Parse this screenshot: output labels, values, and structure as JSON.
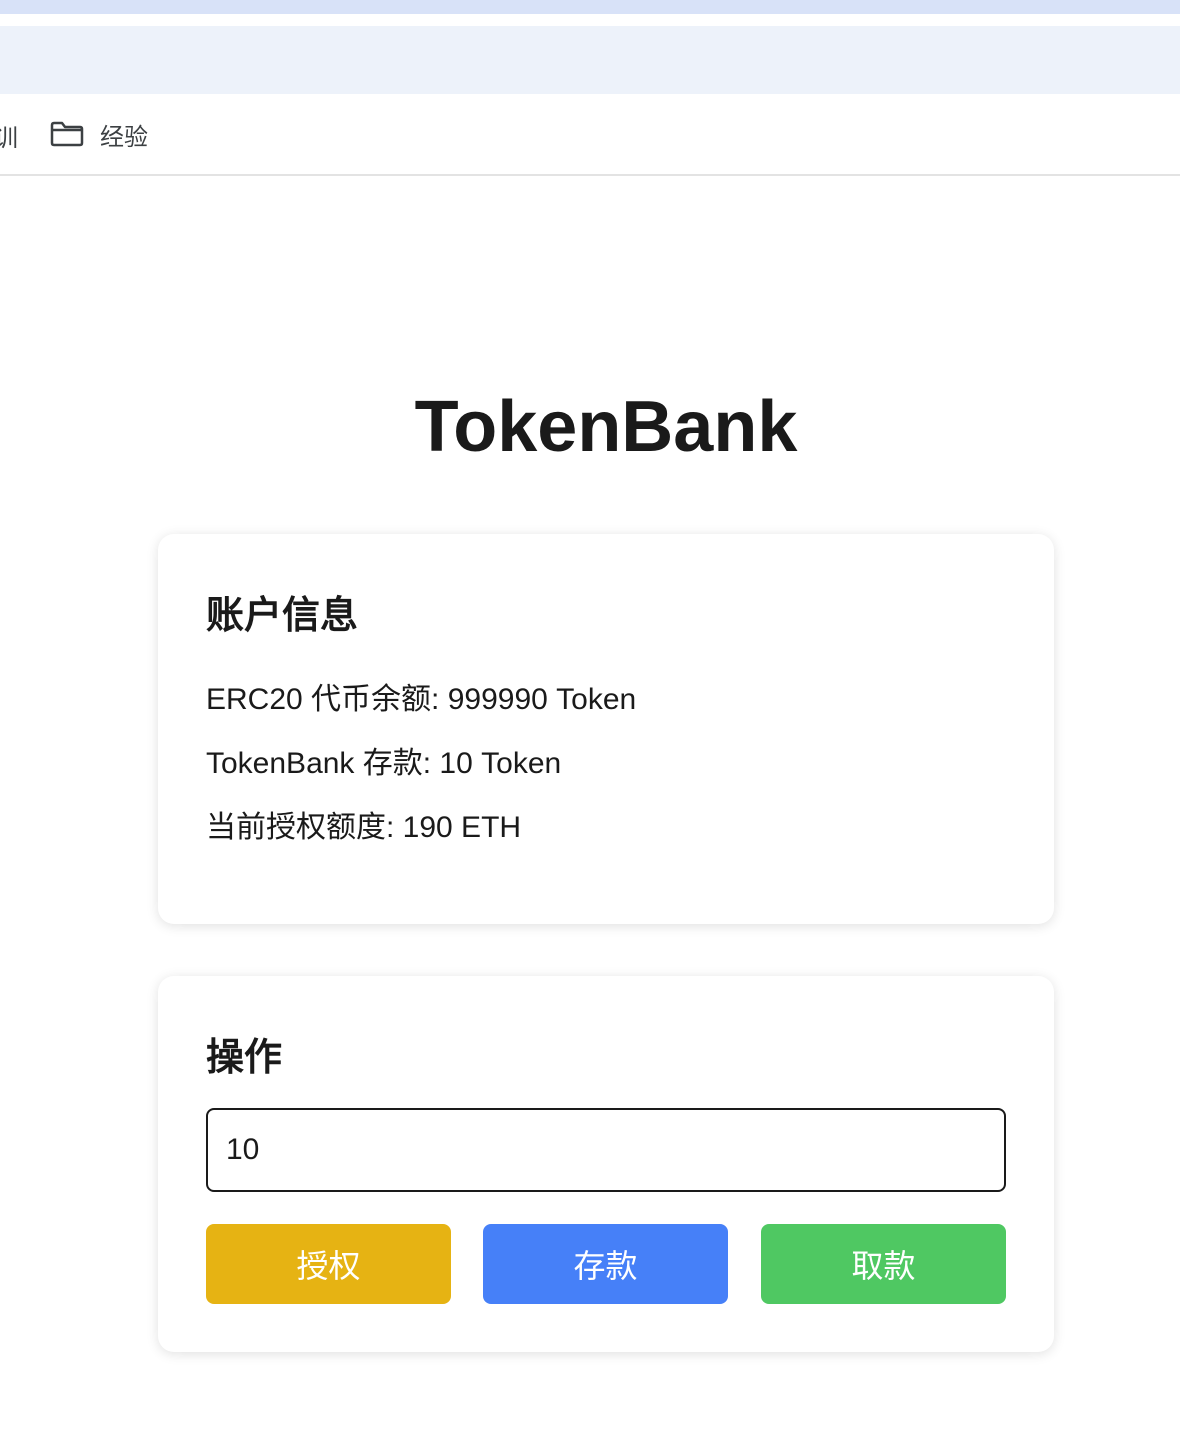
{
  "browser": {
    "bookmarks": {
      "partial_item": "训",
      "folder_label": "经验",
      "folder_icon": "folder-icon"
    }
  },
  "page": {
    "title": "TokenBank"
  },
  "account": {
    "heading": "账户信息",
    "erc20_balance": "ERC20 代币余额: 999990 Token",
    "bank_deposit": "TokenBank 存款: 10 Token",
    "allowance": "当前授权额度: 190 ETH"
  },
  "actions": {
    "heading": "操作",
    "amount_value": "10",
    "approve_label": "授权",
    "deposit_label": "存款",
    "withdraw_label": "取款",
    "colors": {
      "approve": "#e6b313",
      "deposit": "#4680f8",
      "withdraw": "#4fc862"
    }
  }
}
